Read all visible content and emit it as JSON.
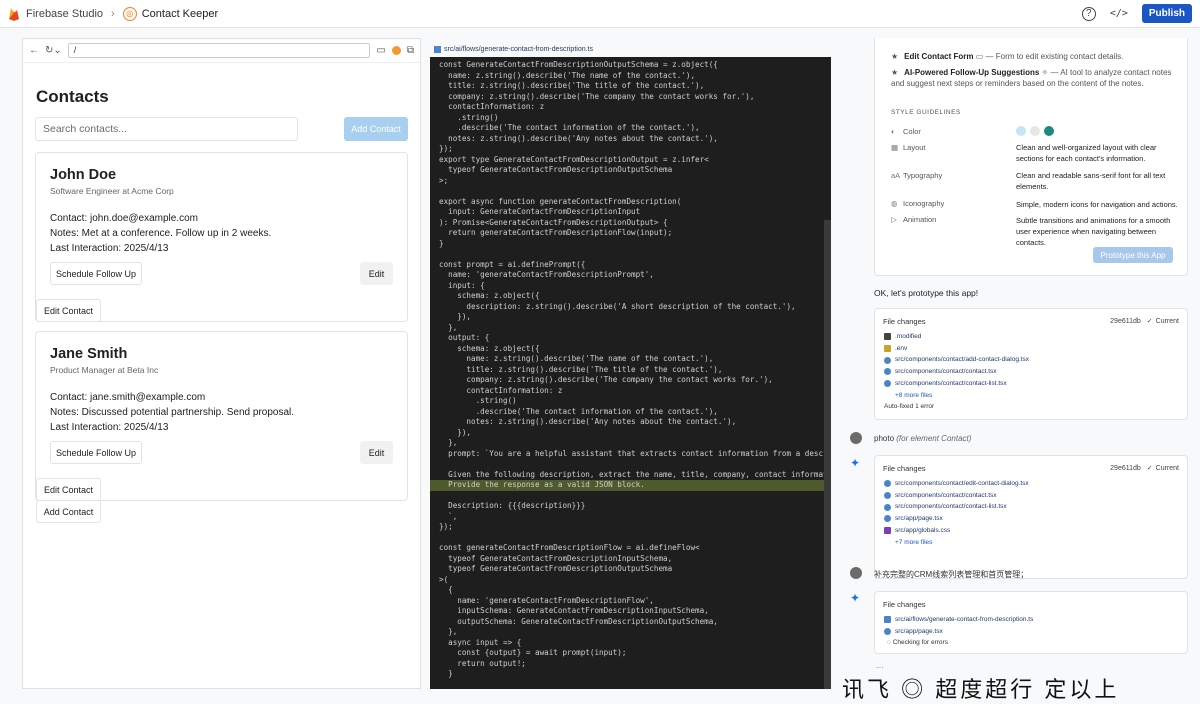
{
  "topbar": {
    "brand": "Firebase Studio",
    "app_name": "Contact Keeper",
    "publish_label": "Publish"
  },
  "preview": {
    "url": "/",
    "title": "Contacts",
    "search_placeholder": "Search contacts...",
    "add_contact_label": "Add Contact",
    "contacts": [
      {
        "name": "John Doe",
        "role": "Software Engineer at Acme Corp",
        "contact": "Contact: john.doe@example.com",
        "notes": "Notes: Met at a conference. Follow up in 2 weeks.",
        "last": "Last Interaction: 2025/4/13",
        "schedule_label": "Schedule Follow Up",
        "edit_label": "Edit",
        "edit_contact_label": "Edit Contact"
      },
      {
        "name": "Jane Smith",
        "role": "Product Manager at Beta Inc",
        "contact": "Contact: jane.smith@example.com",
        "notes": "Notes: Discussed potential partnership. Send proposal.",
        "last": "Last Interaction: 2025/4/13",
        "schedule_label": "Schedule Follow Up",
        "edit_label": "Edit",
        "edit_contact_label": "Edit Contact"
      }
    ],
    "bottom_add_contact_label": "Add Contact"
  },
  "editor": {
    "tab_path": "src/ai/flows/generate-contact-from-description.ts",
    "code": "const GenerateContactFromDescriptionOutputSchema = z.object({\n  name: z.string().describe('The name of the contact.'),\n  title: z.string().describe('The title of the contact.'),\n  company: z.string().describe('The company the contact works for.'),\n  contactInformation: z\n    .string()\n    .describe('The contact information of the contact.'),\n  notes: z.string().describe('Any notes about the contact.'),\n});\nexport type GenerateContactFromDescriptionOutput = z.infer<\n  typeof GenerateContactFromDescriptionOutputSchema\n>;\n\nexport async function generateContactFromDescription(\n  input: GenerateContactFromDescriptionInput\n): Promise<GenerateContactFromDescriptionOutput> {\n  return generateContactFromDescriptionFlow(input);\n}\n\nconst prompt = ai.definePrompt({\n  name: 'generateContactFromDescriptionPrompt',\n  input: {\n    schema: z.object({\n      description: z.string().describe('A short description of the contact.'),\n    }),\n  },\n  output: {\n    schema: z.object({\n      name: z.string().describe('The name of the contact.'),\n      title: z.string().describe('The title of the contact.'),\n      company: z.string().describe('The company the contact works for.'),\n      contactInformation: z\n        .string()\n        .describe('The contact information of the contact.'),\n      notes: z.string().describe('Any notes about the contact.'),\n    }),\n  },\n  prompt: `You are a helpful assistant that extracts contact information from a descri\n\n  Given the following description, extract the name, title, company, contact informati",
    "code_highlight": "  Provide the response as a valid JSON block.",
    "code_after": "\n  Description: {{{description}}}\n  `,\n});\n\nconst generateContactFromDescriptionFlow = ai.defineFlow<\n  typeof GenerateContactFromDescriptionInputSchema,\n  typeof GenerateContactFromDescriptionOutputSchema\n>(\n  {\n    name: 'generateContactFromDescriptionFlow',\n    inputSchema: GenerateContactFromDescriptionInputSchema,\n    outputSchema: GenerateContactFromDescriptionOutputSchema,\n  },\n  async input => {\n    const {output} = await prompt(input);\n    return output!;\n  }"
  },
  "chat": {
    "features": [
      {
        "title": "Edit Contact Form",
        "desc": "— Form to edit existing contact details."
      },
      {
        "title": "AI-Powered Follow-Up Suggestions",
        "desc": "— AI tool to analyze contact notes and suggest next steps or reminders based on the content of the notes."
      }
    ],
    "style_title": "STYLE GUIDELINES",
    "style": [
      {
        "label": "Color",
        "value": ""
      },
      {
        "label": "Layout",
        "value": "Clean and well-organized layout with clear sections for each contact's information."
      },
      {
        "label": "Typography",
        "value": "Clean and readable sans-serif font for all text elements."
      },
      {
        "label": "Iconography",
        "value": "Simple, modern icons for navigation and actions."
      },
      {
        "label": "Animation",
        "value": "Subtle transitions and animations for a smooth user experience when navigating between contacts."
      }
    ],
    "colors": [
      "#c6e5f5",
      "#e6e6e6",
      "#1c8a7e"
    ],
    "prototype_label": "Prototype this App",
    "ok_message": "OK, let's prototype this app!",
    "file_changes_label": "File changes",
    "current_label": "Current",
    "card1": {
      "hash": "29e611db",
      "files": [
        ".modified",
        ".env",
        "src/components/contact/add-contact-dialog.tsx",
        "src/components/contact/contact.tsx",
        "src/components/contact/contact-list.tsx"
      ],
      "more": "+8 more files",
      "fixed": "Auto-fixed 1 error"
    },
    "user_msg1": "photo",
    "user_msg1_note": "(for element Contact)",
    "card2": {
      "hash": "29e611db",
      "files": [
        "src/components/contact/edit-contact-dialog.tsx",
        "src/components/contact/contact.tsx",
        "src/components/contact/contact-list.tsx",
        "src/app/page.tsx",
        "src/app/globals.css"
      ],
      "more": "+7 more files"
    },
    "user_msg2": "补充完整的CRM线索列表管理和首页管理；",
    "card3": {
      "files": [
        "src/ai/flows/generate-contact-from-description.ts",
        "src/app/page.tsx"
      ],
      "status": "Checking for errors"
    },
    "overlay_text": "讯飞 ◎ 超度超行 定以上"
  }
}
